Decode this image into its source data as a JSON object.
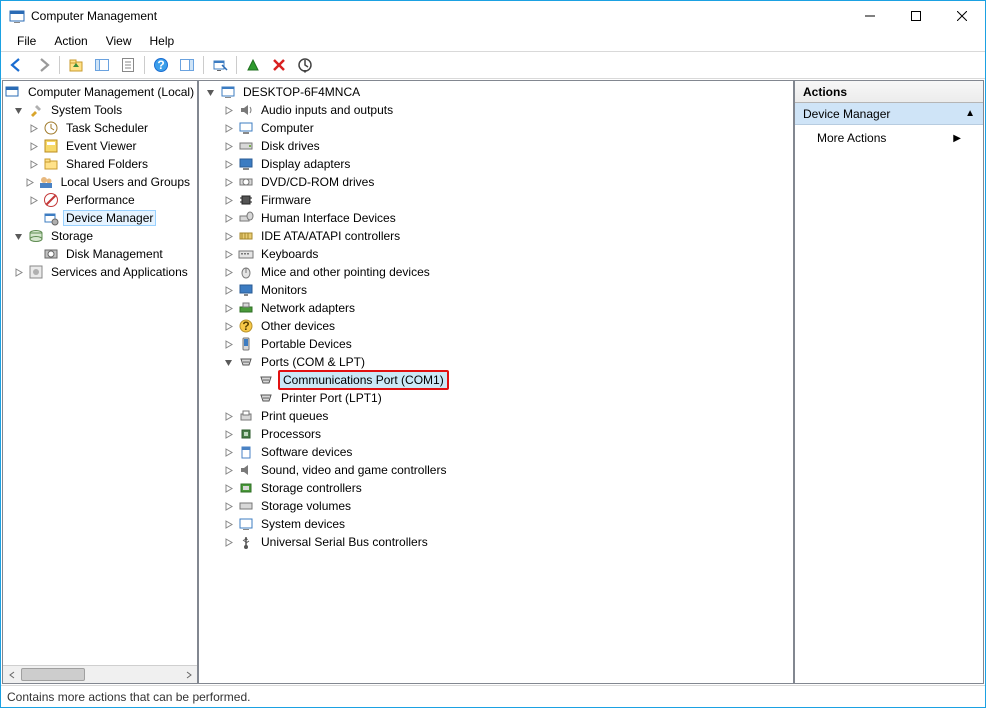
{
  "window": {
    "title": "Computer Management"
  },
  "menu": {
    "file": "File",
    "action": "Action",
    "view": "View",
    "help": "Help"
  },
  "statusbar": {
    "text": "Contains more actions that can be performed."
  },
  "actions": {
    "header": "Actions",
    "group": "Device Manager",
    "more": "More Actions"
  },
  "left_tree": {
    "root": "Computer Management (Local)",
    "system_tools": "System Tools",
    "task_scheduler": "Task Scheduler",
    "event_viewer": "Event Viewer",
    "shared_folders": "Shared Folders",
    "local_users": "Local Users and Groups",
    "performance": "Performance",
    "device_manager": "Device Manager",
    "storage": "Storage",
    "disk_management": "Disk Management",
    "services_apps": "Services and Applications"
  },
  "device_tree": {
    "root": "DESKTOP-6F4MNCA",
    "audio": "Audio inputs and outputs",
    "computer": "Computer",
    "disk_drives": "Disk drives",
    "display": "Display adapters",
    "dvd": "DVD/CD-ROM drives",
    "firmware": "Firmware",
    "hid": "Human Interface Devices",
    "ide": "IDE ATA/ATAPI controllers",
    "keyboards": "Keyboards",
    "mice": "Mice and other pointing devices",
    "monitors": "Monitors",
    "network": "Network adapters",
    "other": "Other devices",
    "portable": "Portable Devices",
    "ports": "Ports (COM & LPT)",
    "com1": "Communications Port (COM1)",
    "lpt1": "Printer Port (LPT1)",
    "print_queues": "Print queues",
    "processors": "Processors",
    "software": "Software devices",
    "sound": "Sound, video and game controllers",
    "storage_ctrl": "Storage controllers",
    "storage_vol": "Storage volumes",
    "system": "System devices",
    "usb": "Universal Serial Bus controllers"
  }
}
